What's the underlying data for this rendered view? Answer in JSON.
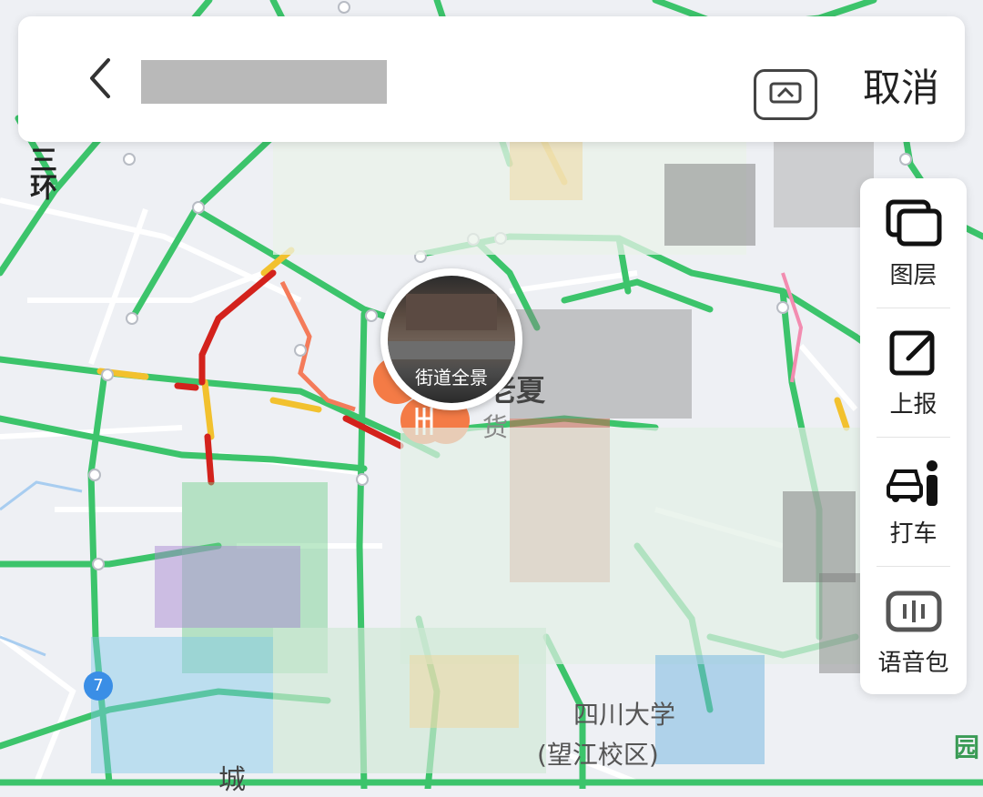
{
  "search_bar": {
    "back_icon": "chevron-left-icon",
    "street_view_icon": "street-view-icon",
    "cancel_label": "取消"
  },
  "side_panel": {
    "items": [
      {
        "label": "图层",
        "icon": "layers-icon"
      },
      {
        "label": "上报",
        "icon": "report-edit-icon"
      },
      {
        "label": "打车",
        "icon": "taxi-icon"
      },
      {
        "label": "语音包",
        "icon": "voice-pack-icon"
      }
    ]
  },
  "street_view_bubble": {
    "label": "街道全景"
  },
  "map_labels": {
    "ring_road": "三环",
    "poi_partial": "老夏",
    "poi_partial_2": "货",
    "university_name": "四川大学",
    "university_campus": "(望江校区)",
    "city_area": "城",
    "park_char": "园",
    "metro_line": "7"
  },
  "colors": {
    "road_green": "#3cc46b",
    "road_yellow": "#f2c12e",
    "road_red": "#d3221c",
    "road_orange": "#f47b5a",
    "poi_orange": "#f47b46",
    "metro_blue": "#3a8ee6"
  }
}
